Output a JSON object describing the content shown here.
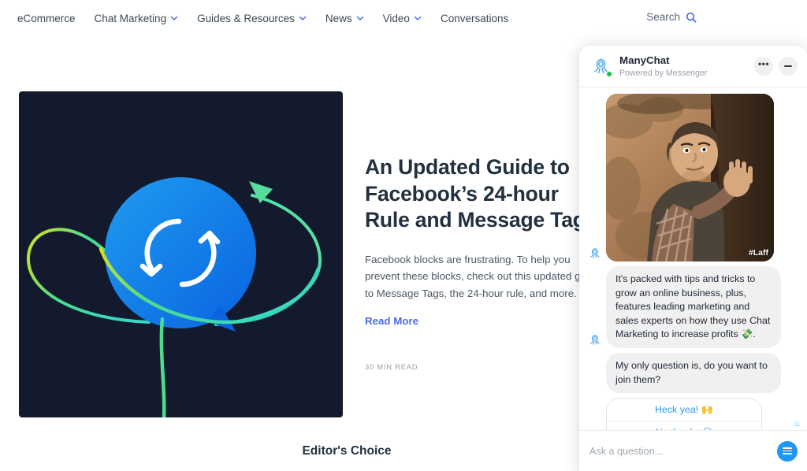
{
  "nav": {
    "items": [
      {
        "label": "eCommerce",
        "has_chevron": false
      },
      {
        "label": "Chat Marketing",
        "has_chevron": true
      },
      {
        "label": "Guides & Resources",
        "has_chevron": true
      },
      {
        "label": "News",
        "has_chevron": true
      },
      {
        "label": "Video",
        "has_chevron": true
      },
      {
        "label": "Conversations",
        "has_chevron": false
      }
    ],
    "search_label": "Search",
    "search_icon": "search-icon",
    "chevron_icon": "chevron-down-icon"
  },
  "hero": {
    "image_alt": "blue-chat-bubble-with-refresh-arrows-illustration",
    "title": "An Updated Guide to Facebook’s 24-hour Rule and Message Tags",
    "description": "Facebook blocks are frustrating. To help you prevent these blocks, check out this updated guide to Message Tags, the 24-hour rule, and more.",
    "read_more": "Read More",
    "read_time": "30 MIN READ"
  },
  "section": {
    "editors_choice": "Editor's Choice"
  },
  "widget": {
    "brand_name": "ManyChat",
    "subtitle": "Powered by Messenger",
    "logo_icon": "manychat-octopus-icon",
    "online": true,
    "options_label": "•••",
    "options_icon": "more-options-icon",
    "minimize_icon": "minimize-icon",
    "gif": {
      "watermark": "#Laff",
      "alt": "man-in-plaid-shirt-by-tree-gif"
    },
    "messages": [
      {
        "type": "text",
        "text": "It's packed with tips and tricks to grow an online business, plus, features leading marketing and sales experts on how they use Chat Marketing to increase profits 💸."
      },
      {
        "type": "text",
        "text": "My only question is, do you want to join them?"
      }
    ],
    "quick_replies": [
      {
        "label": "Heck yea! 🙌"
      },
      {
        "label": "No thanks ☹"
      }
    ],
    "seen_icon": "seen-indicator-icon",
    "input_placeholder": "Ask a question...",
    "input_value": "",
    "send_icon": "menu-send-icon"
  },
  "colors": {
    "accent_blue": "#4a6ce8",
    "messenger_blue": "#2d9cfb",
    "send_blue": "#1f97f5",
    "hero_bg": "#141a2e",
    "bubble_gray": "#f0f0f0",
    "online_green": "#15c241",
    "text_dark": "#22303f"
  }
}
